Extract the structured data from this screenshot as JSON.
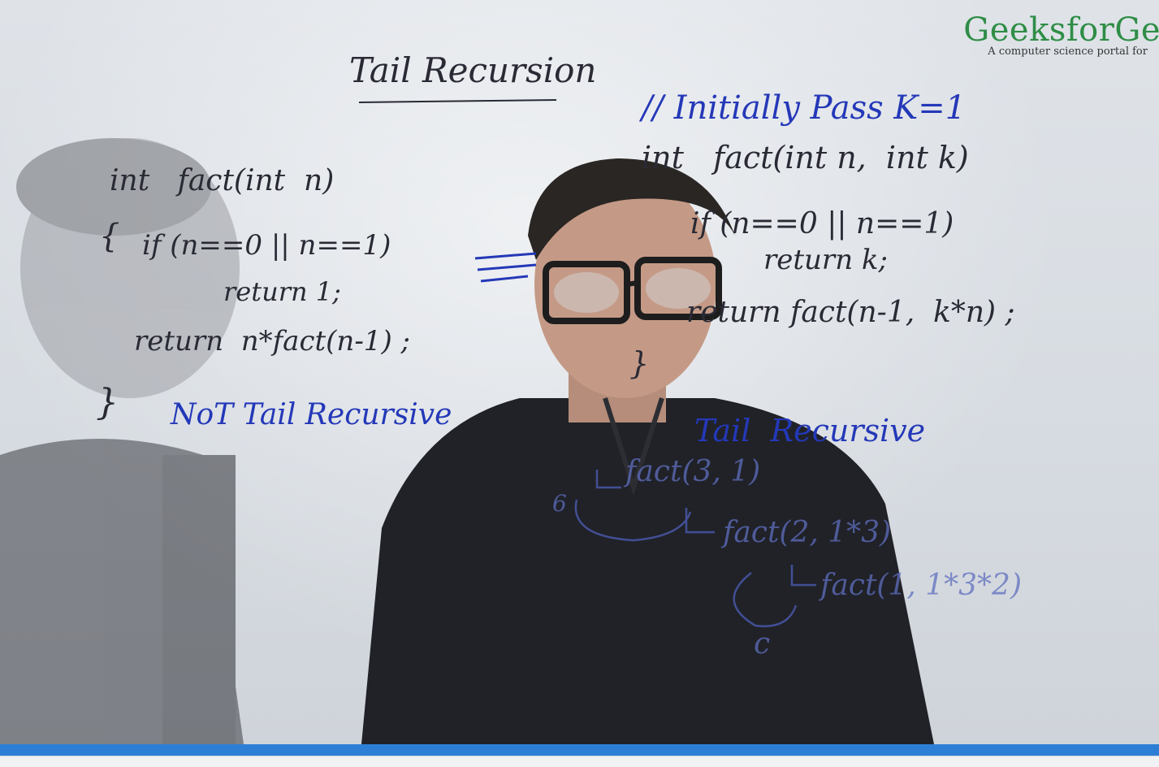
{
  "logo": {
    "name": "GeeksforGe",
    "tagline": "A computer science portal for"
  },
  "board": {
    "title": "Tail Recursion",
    "left_code": [
      "int   fact(int  n)",
      "{",
      "if (n==0 || n==1)",
      "return 1;",
      "return  n*fact(n-1) ;",
      "}"
    ],
    "left_label": "NoT Tail Recursive",
    "comment": "// Initially Pass K=1",
    "right_code": [
      "int   fact(int n,  int k)",
      "if (n==0 || n==1)",
      "return k;",
      "return fact(n-1,  k*n) ;",
      "}"
    ],
    "right_label": "Tail  Recursive",
    "trace": [
      "fact(3, 1)",
      "fact(2, 1*3)",
      "fact(1, 1*3*2)"
    ],
    "trace_result": "6",
    "trace_c": "c"
  },
  "video": {
    "progress": 1.0
  },
  "colors": {
    "ink_blue": "#2438b8",
    "ink_dark": "#2a2a35",
    "logo_green": "#2f8d46",
    "progress": "#2d7fd6"
  }
}
